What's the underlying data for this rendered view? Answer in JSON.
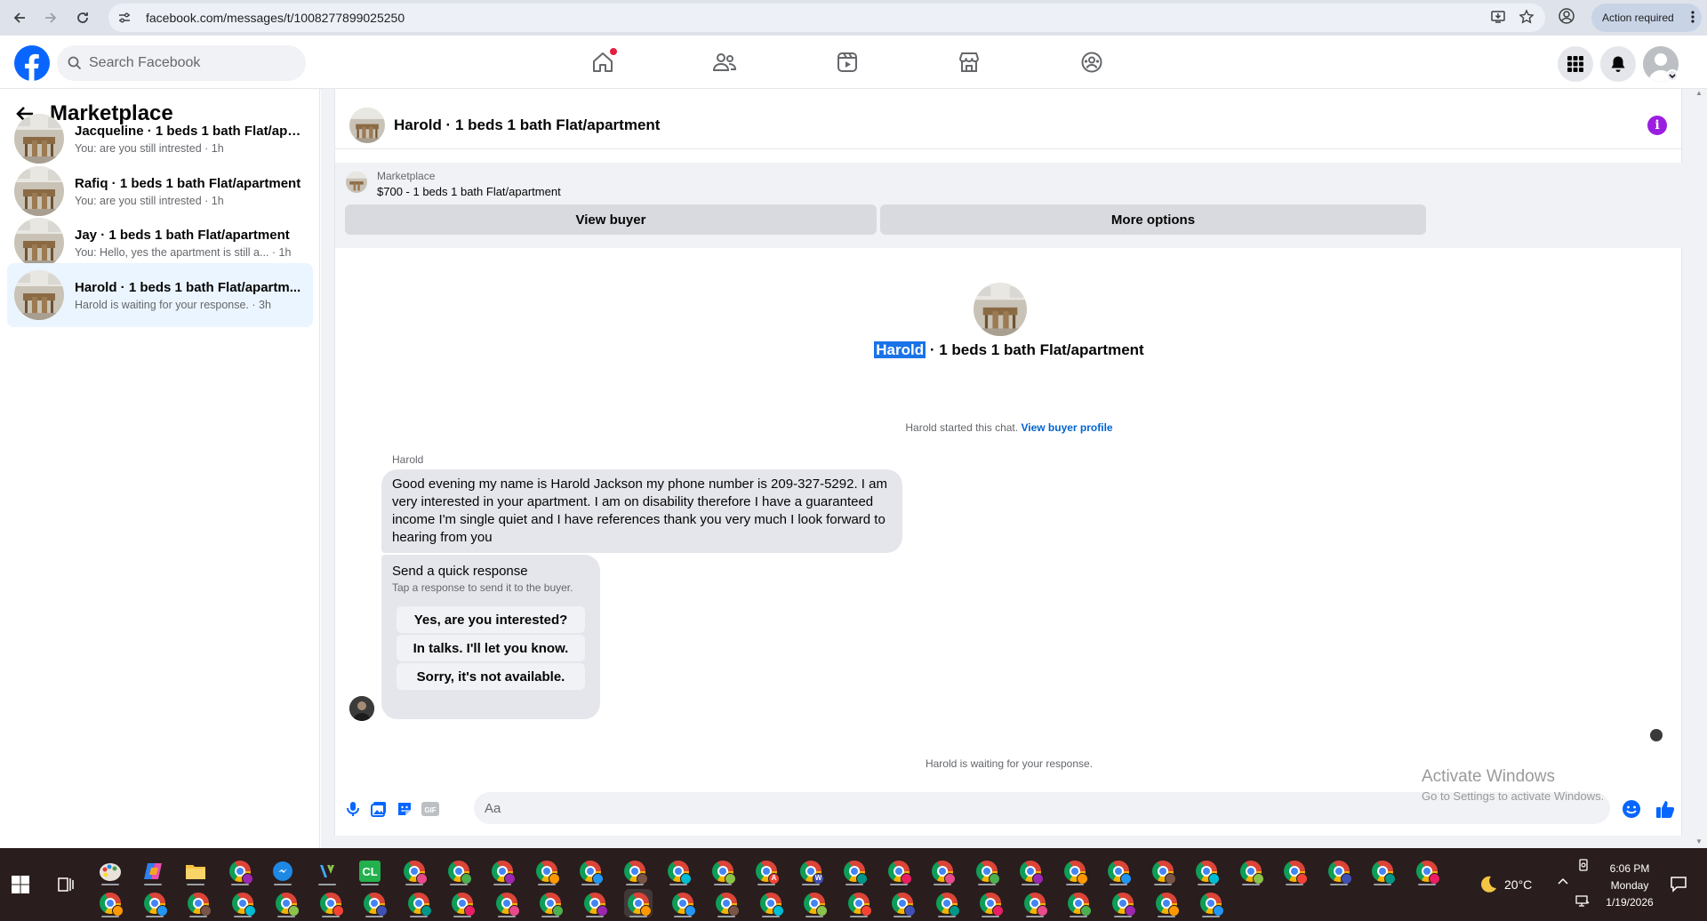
{
  "browser": {
    "url": "facebook.com/messages/t/1008277899025250",
    "action_required": "Action required"
  },
  "fb": {
    "search_placeholder": "Search Facebook"
  },
  "sidebar": {
    "title": "Marketplace",
    "conversations": [
      {
        "title": "Jacqueline · 1 beds 1 bath Flat/apa...",
        "preview": "You: are you still intrested",
        "time": "1h"
      },
      {
        "title": "Rafiq · 1 beds 1 bath Flat/apartment",
        "preview": "You: are you still intrested",
        "time": "1h"
      },
      {
        "title": "Jay · 1 beds 1 bath Flat/apartment",
        "preview": "You: Hello, yes the apartment is still a...",
        "time": "1h"
      },
      {
        "title": "Harold · 1 beds 1 bath Flat/apartm...",
        "preview": "Harold is waiting for your response.",
        "time": "3h"
      }
    ]
  },
  "chat": {
    "header_title": "Harold · 1 beds 1 bath Flat/apartment",
    "banner": {
      "label": "Marketplace",
      "listing": "$700 - 1 beds 1 bath Flat/apartment",
      "view_buyer": "View buyer",
      "more_options": "More options"
    },
    "center_name": "Harold",
    "center_rest": " · 1 beds 1 bath Flat/apartment",
    "started_text": "Harold started this chat.",
    "view_buyer_profile": "View buyer profile",
    "sender": "Harold",
    "message": "Good evening my name is Harold Jackson my phone number is 209-327-5292. I am very interested in your apartment. I am on disability therefore I have a guaranteed income I'm single quiet and I have references thank you very much I look forward to hearing from you",
    "quick_response": {
      "title": "Send a quick response",
      "subtitle": "Tap a response to send it to the buyer.",
      "options": [
        "Yes, are you interested?",
        "In talks. I'll let you know.",
        "Sorry, it's not available."
      ]
    },
    "waiting": "Harold is waiting for your response.",
    "compose_placeholder": "Aa",
    "gif_label": "GIF"
  },
  "watermark": {
    "line1": "Activate Windows",
    "line2": "Go to Settings to activate Windows."
  },
  "taskbar": {
    "weather": "20°C",
    "time": "6:06 PM",
    "day": "Monday",
    "date": "1/19/2026",
    "cl_label": "CL",
    "a_badge": "A",
    "w_badge": "W"
  },
  "colors": {
    "fb_blue": "#0866ff",
    "link_blue": "#0064d1",
    "selection": "#1a73e8",
    "info_purple": "#9b1ee0",
    "taskbar_bg": "#2a1d1d"
  }
}
